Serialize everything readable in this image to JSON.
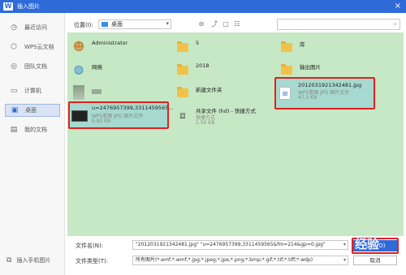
{
  "window": {
    "title": "插入图片",
    "close": "×"
  },
  "sidebar": {
    "items": [
      {
        "label": "最近访问",
        "icon": "clock-icon"
      },
      {
        "label": "WPS云文档",
        "icon": "cloud-icon"
      },
      {
        "label": "团队文档",
        "icon": "team-icon"
      },
      {
        "label": "计算机",
        "icon": "computer-icon"
      },
      {
        "label": "桌面",
        "icon": "desktop-icon",
        "active": true
      },
      {
        "label": "我的文档",
        "icon": "document-icon"
      }
    ],
    "footer": "插入手机图片"
  },
  "toolbar": {
    "location_label": "位置(I):",
    "location_value": "桌面",
    "search_placeholder": ""
  },
  "files": [
    {
      "name": "Administrator",
      "type": "user-folder"
    },
    {
      "name": "5",
      "type": "folder"
    },
    {
      "name": "库",
      "type": "folder"
    },
    {
      "name": "网络",
      "type": "network"
    },
    {
      "name": "2018",
      "type": "folder"
    },
    {
      "name": "输出图片",
      "type": "folder"
    },
    {
      "name": "",
      "type": "blurred"
    },
    {
      "name": "新建文件夹",
      "type": "folder"
    },
    {
      "name": "201203192134248​1.jpg",
      "type": "image",
      "meta1": "WPS看图 JPG 图片文件",
      "meta2": "47.3 KB"
    },
    {
      "name": "u=2476957399,3311459565...",
      "type": "image-dark",
      "meta1": "WPS看图 JPG 图片文件",
      "meta2": "9.82 KB"
    },
    {
      "name": "共享文件 (hd) - 快捷方式",
      "type": "shortcut",
      "meta1": "快捷方式",
      "meta2": "1.50 KB"
    }
  ],
  "footer": {
    "filename_label": "文件名(N):",
    "filename_value": "\"2012031921342481.jpg\" \"u=2476957399,3311459565&fm=214&gp=0.jpg\"",
    "filetype_label": "文件类型(T):",
    "filetype_value": "所有图片(*.emf;*.wmf;*.jpg;*.jpeg;*.jpe;*.png;*.bmp;*.gif;*.tif;*.tiff;*.wdp)",
    "open_label": "打开(O)",
    "cancel_label": "取消"
  },
  "watermark": "经验"
}
